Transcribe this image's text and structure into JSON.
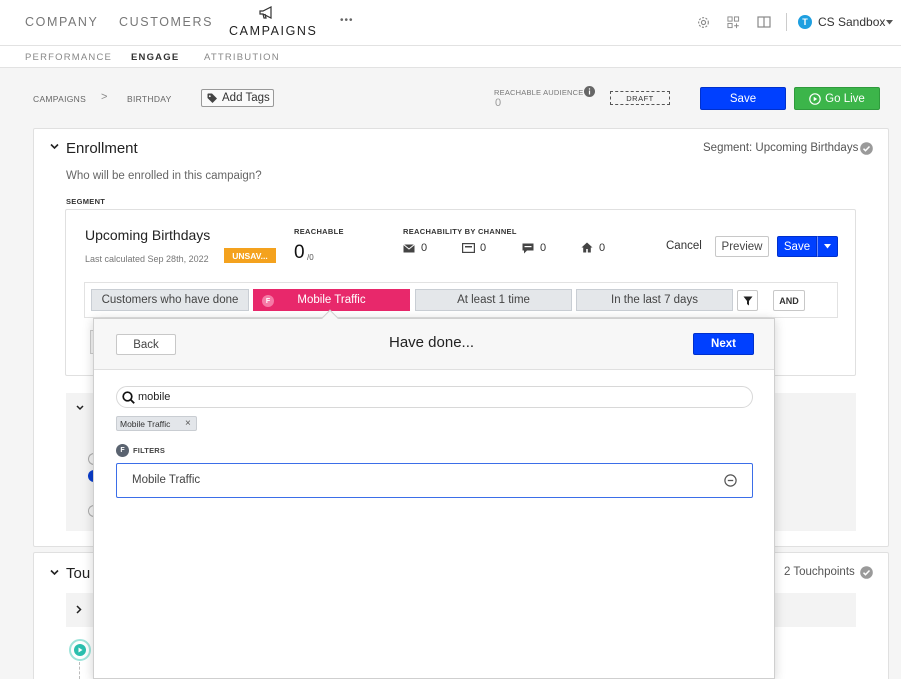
{
  "nav": {
    "company": "COMPANY",
    "customers": "CUSTOMERS",
    "campaigns": "CAMPAIGNS",
    "more": "•••",
    "account": "CS Sandbox",
    "account_initial": "T"
  },
  "subnav": {
    "performance": "PERFORMANCE",
    "engage": "ENGAGE",
    "attribution": "ATTRIBUTION"
  },
  "header": {
    "crumb_campaigns": "CAMPAIGNS",
    "crumb_sep": ">",
    "crumb_birthday": "BIRTHDAY",
    "add_tags": "Add Tags",
    "reachable_audience_label": "REACHABLE AUDIENCE",
    "reachable_audience_value": "0",
    "draft": "DRAFT",
    "save": "Save",
    "go_live": "Go Live"
  },
  "enrollment": {
    "title": "Enrollment",
    "segment_summary": "Segment: Upcoming Birthdays",
    "question": "Who will be enrolled in this campaign?",
    "segment_label": "SEGMENT",
    "segment_name": "Upcoming Birthdays",
    "last_calculated": "Last calculated Sep 28th, 2022",
    "unsaved_badge": "UNSAV...",
    "reachable_label": "REACHABLE",
    "reachable_value": "0",
    "reachable_total": "/0",
    "channel_label": "REACHABILITY BY CHANNEL",
    "channels": [
      {
        "icon": "email-icon",
        "value": "0"
      },
      {
        "icon": "sms-icon",
        "value": "0"
      },
      {
        "icon": "chat-icon",
        "value": "0"
      },
      {
        "icon": "home-icon",
        "value": "0"
      }
    ],
    "cancel": "Cancel",
    "preview": "Preview",
    "save": "Save",
    "condition": {
      "customers_who": "Customers who have done",
      "event_badge": "F",
      "event": "Mobile Traffic",
      "frequency": "At least 1 time",
      "timeframe": "In the last 7 days",
      "and": "AND"
    }
  },
  "touchpoints": {
    "title_partial": "Tou",
    "count": "2 Touchpoints"
  },
  "modal": {
    "back": "Back",
    "title": "Have done...",
    "next": "Next",
    "search_value": "mobile",
    "search_chip": "Mobile Traffic",
    "filters_badge": "F",
    "filters_label": "FILTERS",
    "result": "Mobile Traffic"
  },
  "colors": {
    "primary": "#0040ff",
    "green": "#3cb54a",
    "pink": "#e8286b",
    "orange": "#f4a21e",
    "teal": "#2bbfae"
  }
}
